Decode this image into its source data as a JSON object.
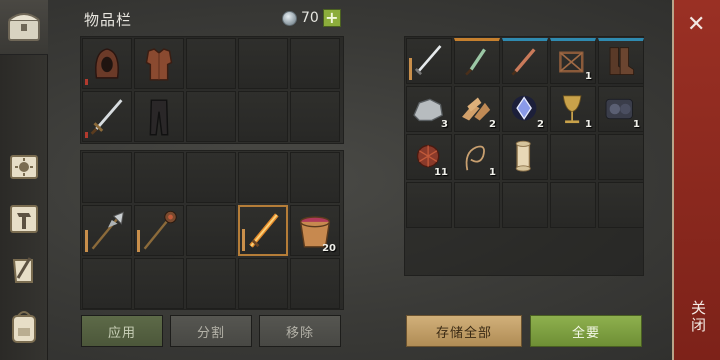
{
  "header": {
    "title": "物品栏",
    "currency_amount": "70",
    "currency_plus": "+"
  },
  "equipment": {
    "slots": [
      {
        "icon": "hood-icon",
        "bar": "red"
      },
      {
        "icon": "leather-armor-icon"
      },
      {
        "icon": ""
      },
      {
        "icon": ""
      },
      {
        "icon": ""
      },
      {
        "icon": "sword-icon",
        "bar": "red"
      },
      {
        "icon": "pants-icon"
      },
      {
        "icon": ""
      },
      {
        "icon": ""
      },
      {
        "icon": ""
      }
    ]
  },
  "inventory": {
    "slots": [
      {
        "icon": ""
      },
      {
        "icon": ""
      },
      {
        "icon": ""
      },
      {
        "icon": ""
      },
      {
        "icon": ""
      },
      {
        "icon": "halberd-icon",
        "bar": "tan"
      },
      {
        "icon": "mace-icon",
        "bar": "tan"
      },
      {
        "icon": ""
      },
      {
        "icon": "flaming-sword-icon",
        "bar": "tan",
        "selected": true
      },
      {
        "icon": "bucket-icon",
        "count": "20"
      },
      {
        "icon": ""
      },
      {
        "icon": ""
      },
      {
        "icon": ""
      },
      {
        "icon": ""
      },
      {
        "icon": ""
      }
    ]
  },
  "storage": {
    "slots": [
      {
        "icon": "longsword-icon",
        "bar": "tan"
      },
      {
        "icon": "green-dagger-icon",
        "top": "orange"
      },
      {
        "icon": "copper-blade-icon",
        "top": "blue"
      },
      {
        "icon": "wood-frame-icon",
        "top": "blue",
        "count": "1"
      },
      {
        "icon": "boots-icon",
        "top": "blue"
      },
      {
        "icon": "stone-icon",
        "count": "3"
      },
      {
        "icon": "wood-chips-icon",
        "count": "2"
      },
      {
        "icon": "crystal-icon",
        "count": "2"
      },
      {
        "icon": "goblet-icon",
        "count": "1"
      },
      {
        "icon": "iron-ore-icon",
        "count": "1"
      },
      {
        "icon": "fiber-bundle-icon",
        "count": "11"
      },
      {
        "icon": "rope-icon",
        "count": "1"
      },
      {
        "icon": "scroll-icon"
      },
      {
        "icon": ""
      },
      {
        "icon": ""
      },
      {
        "icon": ""
      },
      {
        "icon": ""
      },
      {
        "icon": ""
      },
      {
        "icon": ""
      },
      {
        "icon": ""
      }
    ]
  },
  "buttons": {
    "apply": "应用",
    "split": "分割",
    "remove": "移除",
    "store_all": "存储全部",
    "take_all": "全要"
  },
  "close": {
    "label": "关闭",
    "x": "✕"
  },
  "colors": {
    "accent_green": "#8cad3c",
    "close_red": "#8a281e",
    "select_orange": "#b57d38",
    "rarity_blue": "#2f8ab0"
  }
}
